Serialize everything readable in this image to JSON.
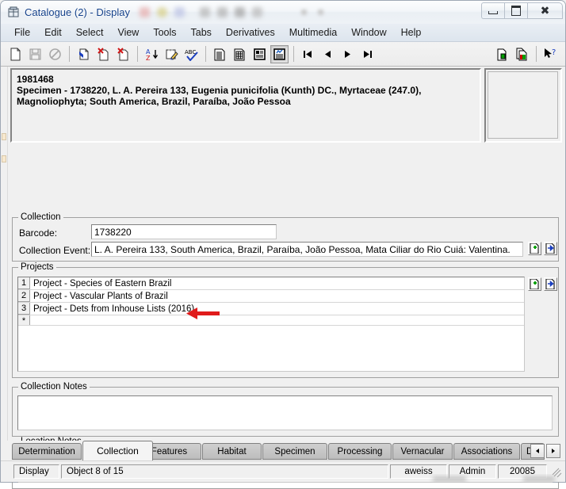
{
  "window": {
    "title": "Catalogue (2) - Display",
    "app_icon": "database-icon",
    "buttons": {
      "minimize": "minimize-icon",
      "maximize": "maximize-icon",
      "close": "close-icon"
    }
  },
  "menubar": {
    "items": [
      "File",
      "Edit",
      "Select",
      "View",
      "Tools",
      "Tabs",
      "Derivatives",
      "Multimedia",
      "Window",
      "Help"
    ]
  },
  "toolbar": {
    "groups": [
      [
        "new-document-icon",
        "save-icon",
        "cancel-icon"
      ],
      [
        "import-record-icon",
        "delete-record-icon",
        "remove-record-icon"
      ],
      [
        "sort-az-icon",
        "edit-note-icon",
        "spellcheck-abc-icon"
      ],
      [
        "view-list-icon",
        "view-grid-icon",
        "view-details-icon",
        "view-report-icon"
      ],
      [
        "nav-first-icon",
        "nav-previous-icon",
        "nav-next-icon",
        "nav-last-icon"
      ]
    ],
    "right_group": [
      "copy-record-icon",
      "duplicate-records-icon",
      "help-pointer-icon"
    ],
    "pressed": "view-report-icon"
  },
  "summary": {
    "lines": [
      "1981468",
      "Specimen - 1738220, L. A. Pereira 133, Eugenia punicifolia (Kunth) DC., Myrtaceae (247.0),",
      "Magnoliophyta;  South America, Brazil, Paraíba, João Pessoa"
    ]
  },
  "thumbnail": {
    "label": "image-preview-panel"
  },
  "collection_group": {
    "title": "Collection",
    "barcode_label": "Barcode:",
    "barcode_value": "1738220",
    "event_label": "Collection Event:",
    "event_value": "L. A. Pereira 133, South America, Brazil, Paraíba, João Pessoa, Mata Ciliar do Rio Cuiá: Valentina.",
    "add_button": "add-record-icon",
    "goto_button": "goto-record-icon"
  },
  "projects_group": {
    "title": "Projects",
    "add_button": "add-record-icon",
    "goto_button": "goto-record-icon",
    "rows": [
      {
        "num": "1",
        "value": "Project - Species of Eastern Brazil"
      },
      {
        "num": "2",
        "value": "Project - Vascular Plants of Brazil"
      },
      {
        "num": "3",
        "value": "Project - Dets from Inhouse Lists (2016)"
      },
      {
        "num": "*",
        "value": ""
      }
    ],
    "annotation": {
      "type": "red-arrow",
      "points_to_row": "3",
      "color": "#e01b1b"
    }
  },
  "collection_notes": {
    "title": "Collection Notes",
    "value": ""
  },
  "location_notes": {
    "title": "Location Notes",
    "value": ""
  },
  "tabs": {
    "items": [
      {
        "label": "Determination",
        "active": false
      },
      {
        "label": "Collection",
        "active": true
      },
      {
        "label": "Features",
        "active": false
      },
      {
        "label": "Habitat",
        "active": false
      },
      {
        "label": "Specimen",
        "active": false
      },
      {
        "label": "Processing",
        "active": false
      },
      {
        "label": "Vernacular",
        "active": false
      },
      {
        "label": "Associations",
        "active": false
      },
      {
        "label": "D",
        "active": false
      }
    ],
    "scroll_left": "chevron-left-icon",
    "scroll_right": "chevron-right-icon"
  },
  "statusbar": {
    "mode": "Display",
    "object": "Object 8 of 15",
    "user": "aweiss",
    "role": "Admin",
    "number": "20085",
    "grip": "resize-grip-icon"
  },
  "colors": {
    "titlebar_text": "#15428b",
    "annotation_red": "#e01b1b",
    "window_face": "#f0f0f0",
    "field_white": "#ffffff"
  }
}
